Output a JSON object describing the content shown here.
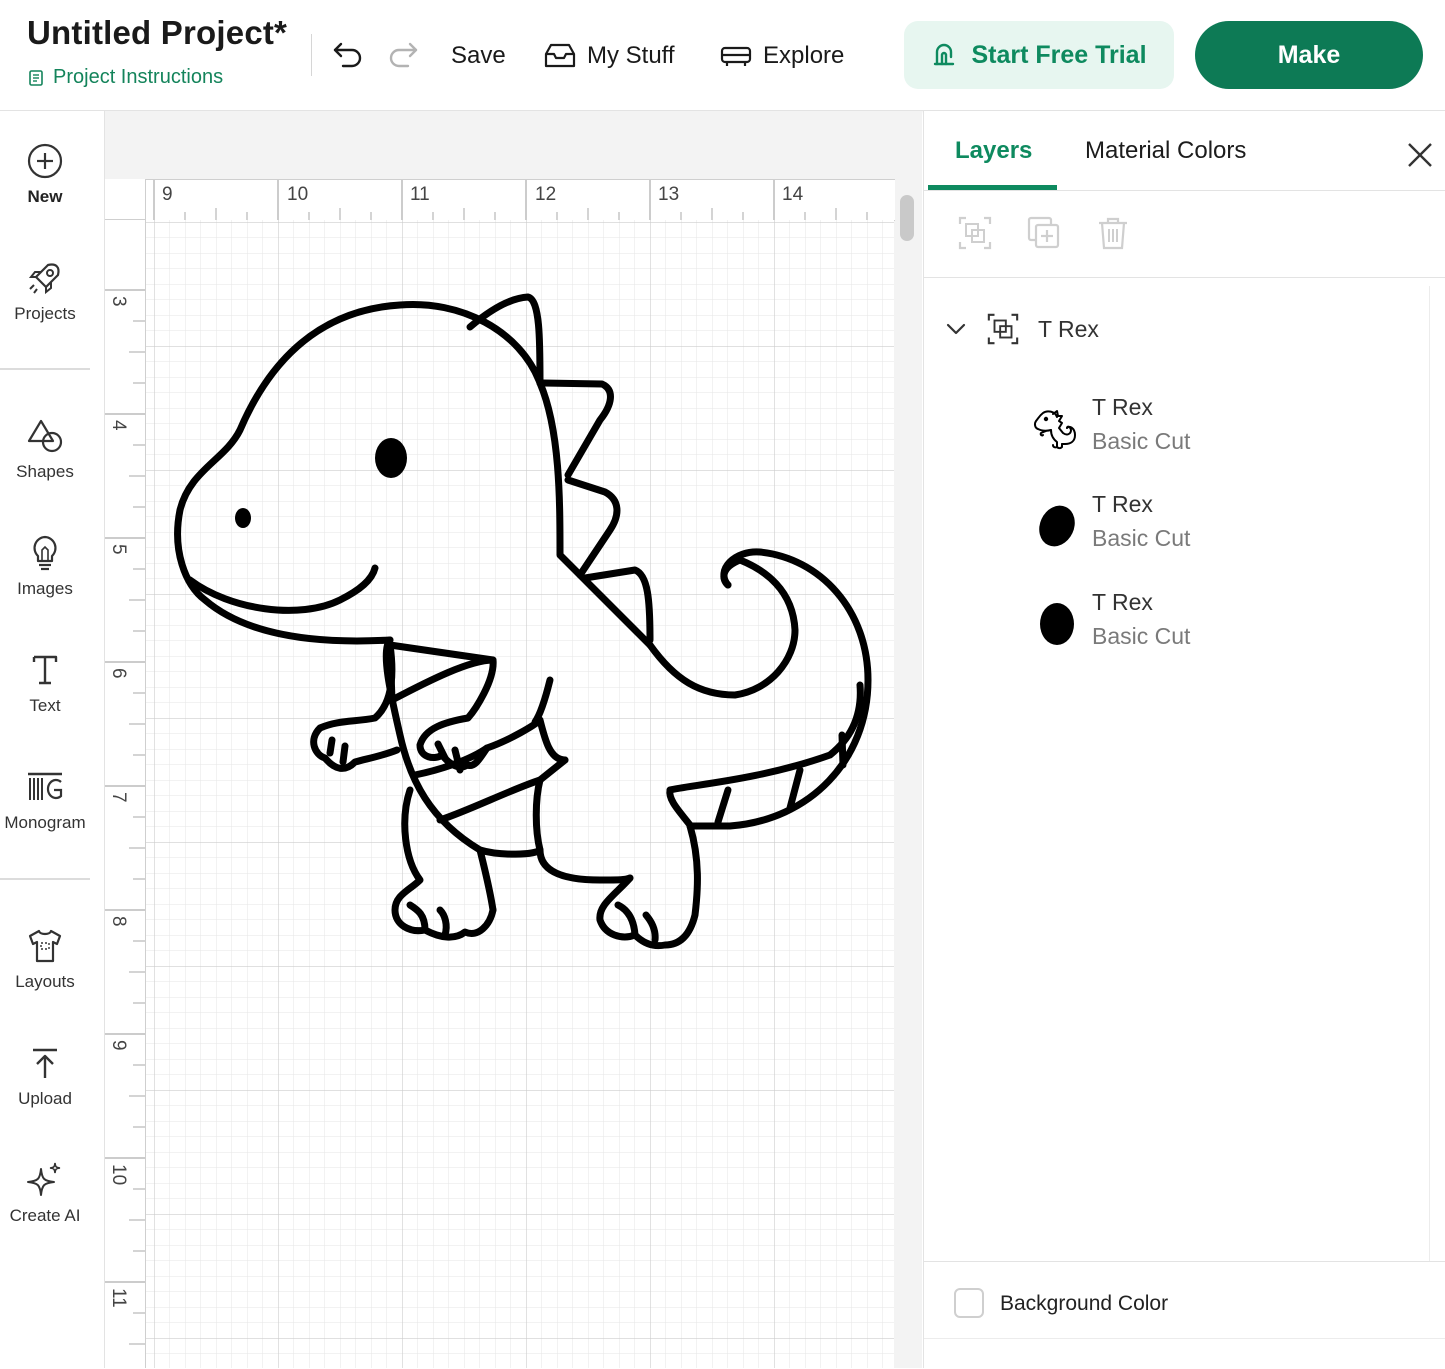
{
  "header": {
    "title": "Untitled Project*",
    "instructions": "Project Instructions",
    "save": "Save",
    "my_stuff": "My Stuff",
    "explore": "Explore",
    "trial": "Start Free Trial",
    "make": "Make"
  },
  "sidebar": {
    "items": [
      {
        "label": "New",
        "icon": "plus-circle-icon"
      },
      {
        "label": "Projects",
        "icon": "rocket-icon"
      },
      {
        "label": "Shapes",
        "icon": "shapes-icon"
      },
      {
        "label": "Images",
        "icon": "lightbulb-icon"
      },
      {
        "label": "Text",
        "icon": "text-icon"
      },
      {
        "label": "Monogram",
        "icon": "monogram-icon"
      },
      {
        "label": "Layouts",
        "icon": "tshirt-icon"
      },
      {
        "label": "Upload",
        "icon": "upload-icon"
      },
      {
        "label": "Create AI",
        "icon": "sparkle-icon"
      }
    ]
  },
  "canvas": {
    "ruler_h": [
      "9",
      "10",
      "11",
      "12",
      "13",
      "14"
    ],
    "ruler_v": [
      "3",
      "4",
      "5",
      "6",
      "7",
      "8",
      "9",
      "10",
      "11"
    ]
  },
  "panel": {
    "tabs": {
      "layers": "Layers",
      "material_colors": "Material Colors"
    },
    "group_name": "T Rex",
    "layers": [
      {
        "name": "T Rex",
        "type": "Basic Cut",
        "thumb": "trex-outline"
      },
      {
        "name": "T Rex",
        "type": "Basic Cut",
        "thumb": "black-oval"
      },
      {
        "name": "T Rex",
        "type": "Basic Cut",
        "thumb": "black-oval"
      }
    ],
    "background_color": "Background Color"
  },
  "colors": {
    "brand_green": "#0d7a55",
    "accent_green": "#0e8a5f",
    "trial_bg": "#e7f6f0"
  }
}
